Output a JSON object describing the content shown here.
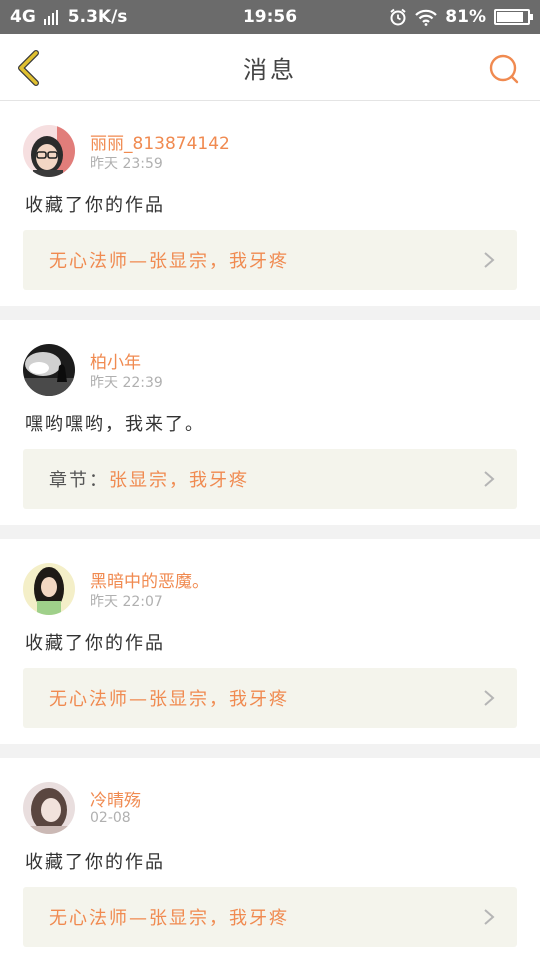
{
  "status_bar": {
    "network": "4G",
    "speed": "5.3K/s",
    "time": "19:56",
    "battery": "81%",
    "battery_level": 0.81
  },
  "nav": {
    "title": "消息",
    "back_icon": "chevron-left-icon",
    "search_icon": "search-icon"
  },
  "colors": {
    "accent": "#f08a50",
    "back_arrow": "#e0c030",
    "link_bg": "#f4f4ec",
    "status_bar": "#6b6b6b"
  },
  "messages": [
    {
      "user": "丽丽_813874142",
      "time": "昨天 23:59",
      "text": "收藏了你的作品",
      "link_prefix": "",
      "link_text": "无心法师—张显宗，我牙疼"
    },
    {
      "user": "柏小年",
      "time": "昨天 22:39",
      "text": "嘿哟嘿哟，我来了。",
      "link_prefix": "章节：",
      "link_text": "张显宗，我牙疼"
    },
    {
      "user": "黑暗中的恶魔。",
      "time": "昨天 22:07",
      "text": "收藏了你的作品",
      "link_prefix": "",
      "link_text": "无心法师—张显宗，我牙疼"
    },
    {
      "user": "冷晴殇",
      "time": "02-08",
      "text": "收藏了你的作品",
      "link_prefix": "",
      "link_text": "无心法师—张显宗，我牙疼"
    }
  ]
}
